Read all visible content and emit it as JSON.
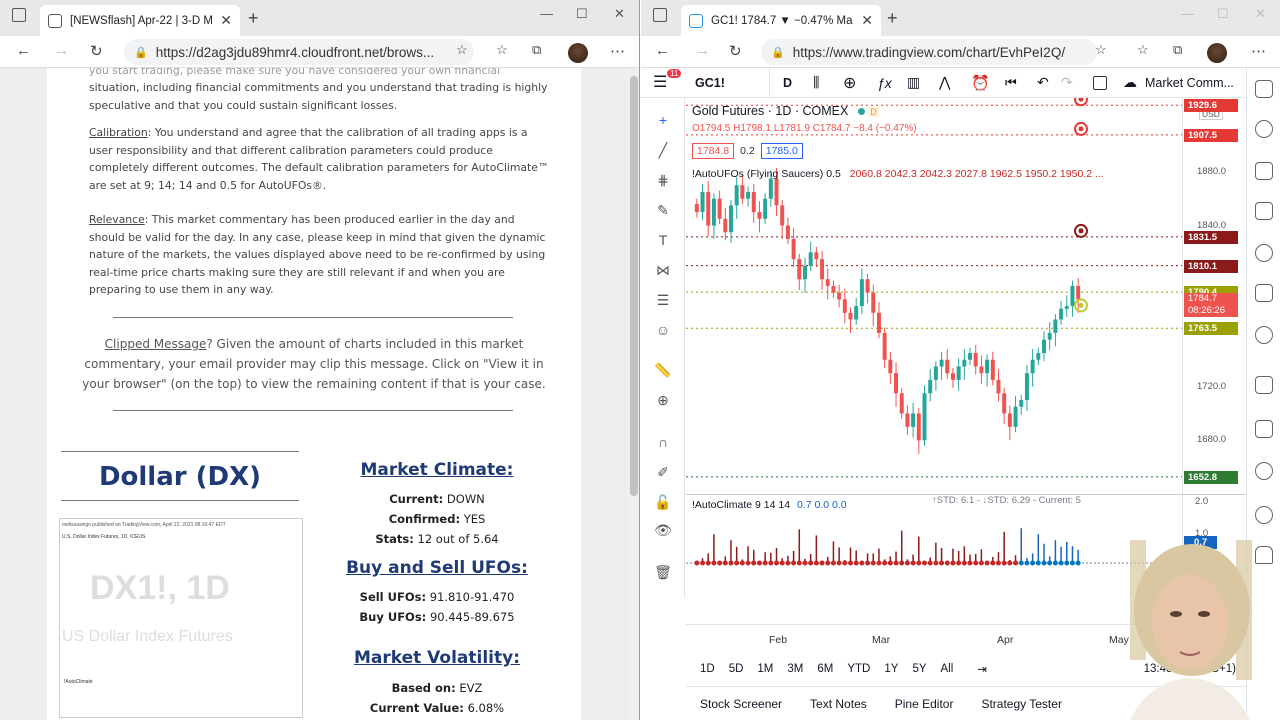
{
  "left_browser": {
    "tab_title": "[NEWSflash] Apr-22 | 3-D Market",
    "url": "https://d2ag3jdu89hmr4.cloudfront.net/brows...",
    "email": {
      "intro_text": "situation, including financial commitments and you understand that trading is highly speculative and that you could sustain significant losses.",
      "calibration_label": "Calibration",
      "calibration_text": ": You understand and agree that the calibration of all trading apps is a user responsibility and that different calibration parameters could produce completely different outcomes. The default calibration parameters for AutoClimate™ are set at 9; 14; 14 and 0.5 for AutoUFOs®.",
      "relevance_label": "Relevance",
      "relevance_text": ": This market commentary has been produced earlier in the day and should be valid for the day. In any case, please keep in mind that given the dynamic nature of the markets, the values displayed above need to be re-confirmed by using real-time price charts making sure they are still relevant if and when you are preparing to use them in any way.",
      "clipped_label": "Clipped Message",
      "clipped_text": "? Given the amount of charts included in this market commentary, your email provider may clip this message. Click on \"View it in your browser\" (on the top) to view the remaining content if that is your case.",
      "instrument_title": "Dollar (DX)",
      "market_climate_heading": "Market Climate:",
      "current_label": "Current:",
      "current_value": "DOWN",
      "confirmed_label": "Confirmed:",
      "confirmed_value": "YES",
      "stats_label": "Stats:",
      "stats_value": "12 out of 5.64",
      "ufos_heading": "Buy and Sell UFOs:",
      "sell_label": "Sell UFOs:",
      "sell_value": "91.810-91.470",
      "buy_label": "Buy UFOs:",
      "buy_value": "90.445-89.675",
      "volatility_heading": "Market Volatility:",
      "based_on_label": "Based on:",
      "based_on_value": "EVZ",
      "current_value_label": "Current Value:",
      "current_value_value": "6.08%",
      "thumb_watermark": "DX1!, 1D",
      "thumb_subtitle": "US Dollar Index Futures",
      "thumb_header": "U.S. Dollar Index Futures, 1D, ICEUS",
      "thumb_osc_label": "!AutoClimate"
    }
  },
  "right_browser": {
    "tab_title": "GC1! 1784.7 ▼ −0.47% Market C",
    "url": "https://www.tradingview.com/chart/EvhPeI2Q/",
    "toolbar": {
      "badge": "11",
      "symbol": "GC1!",
      "interval": "D",
      "layout_name": "Market Comm..."
    },
    "legend": {
      "title": "Gold Futures · 1D · COMEX",
      "ohlc": "O1794.5 H1798.1 L1781.9 C1784.7 −8.4 (−0.47%)",
      "bid": "1784.8",
      "spread": "0.2",
      "ask": "1785.0",
      "indicator": "!AutoUFOs (Flying Saucers) 0.5",
      "indicator_values": "2060.8  2042.3  2042.3  2027.8  1962.5  1950.2  1950.2  ..."
    },
    "price_scale": {
      "currency": "USD",
      "ticks": [
        "1880.0",
        "1840.0",
        "1760.0",
        "1720.0",
        "1680.0"
      ],
      "labels": [
        {
          "text": "1929.6",
          "color": "#e53935"
        },
        {
          "text": "1907.5",
          "color": "#e53935"
        },
        {
          "text": "1831.5",
          "color": "#8b1a1a"
        },
        {
          "text": "1810.1",
          "color": "#8b1a1a"
        },
        {
          "text": "1790.4",
          "color": "#9aa000"
        },
        {
          "text": "1763.5",
          "color": "#9aa000"
        },
        {
          "text": "1652.8",
          "color": "#2e7d32"
        }
      ],
      "last_price": "1784.7",
      "countdown": "08:26:26"
    },
    "oscillator": {
      "title": "!AutoClimate 9 14 14",
      "values": "0.7  0.0  0.0",
      "stats": "↑STD: 6.1 - ↓STD: 6.29 - Current: 5",
      "scale_top": "2.0",
      "scale_mid": "1.0",
      "last_value": "0.7"
    },
    "time_axis": [
      "Feb",
      "Mar",
      "Apr",
      "May"
    ],
    "ranges": [
      "1D",
      "5D",
      "1M",
      "3M",
      "6M",
      "YTD",
      "1Y",
      "5Y",
      "All"
    ],
    "clock": "13:43:33 (UTC+1)",
    "bottom_tabs": [
      "Stock Screener",
      "Text Notes",
      "Pine Editor",
      "Strategy Tester"
    ]
  },
  "chart_data": {
    "type": "candlestick",
    "title": "Gold Futures · 1D · COMEX",
    "x_range": [
      "Jan",
      "Apr-22"
    ],
    "ylim": [
      1640,
      1935
    ],
    "closes": [
      1850,
      1865,
      1840,
      1860,
      1845,
      1835,
      1855,
      1870,
      1860,
      1865,
      1850,
      1845,
      1860,
      1875,
      1855,
      1840,
      1830,
      1815,
      1800,
      1810,
      1820,
      1815,
      1800,
      1795,
      1790,
      1785,
      1775,
      1770,
      1780,
      1800,
      1790,
      1775,
      1760,
      1740,
      1730,
      1715,
      1700,
      1690,
      1700,
      1680,
      1715,
      1725,
      1735,
      1740,
      1730,
      1725,
      1735,
      1740,
      1745,
      1735,
      1730,
      1740,
      1725,
      1715,
      1700,
      1690,
      1705,
      1710,
      1730,
      1740,
      1745,
      1755,
      1760,
      1770,
      1778,
      1780,
      1795,
      1785
    ],
    "horizontal_levels": [
      1929.6,
      1907.5,
      1831.5,
      1810.1,
      1790.4,
      1763.5,
      1652.8
    ]
  }
}
